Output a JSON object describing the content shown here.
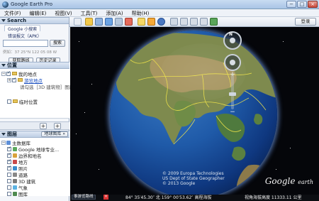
{
  "window": {
    "title": "Google Earth Pro",
    "minimize": "−",
    "maximize": "□",
    "close": "×"
  },
  "menu": [
    "文件(F)",
    "编辑(E)",
    "视图(V)",
    "工具(T)",
    "添加(A)",
    "帮助(H)"
  ],
  "search": {
    "header": "Search",
    "tab1": "Google 小搜索",
    "tab2": "错误报文（APK）",
    "placeholder": "",
    "button": "搜索",
    "hint": "例如：37 25°N 122 05 08 W",
    "link_directions": "获取路线",
    "link_history": "历史记录"
  },
  "places": {
    "header": "位置",
    "items": [
      {
        "label": "我的地点",
        "checked": true
      },
      {
        "label": "游览地点",
        "checked": true
      },
      {
        "label": "请勾选［3D 建筑物］图层",
        "checked": false
      },
      {
        "label": "临时位置",
        "checked": false
      }
    ]
  },
  "layers": {
    "header": "图层",
    "gallery_button": "地球图库 »",
    "items": [
      {
        "label": "主数据库",
        "icon_color": "#5d8fd8",
        "checked": false
      },
      {
        "label": "Google 地球专业...",
        "icon_color": "#5aa95d",
        "checked": true
      },
      {
        "label": "边界和地名",
        "icon_color": "#d9a23a",
        "checked": true
      },
      {
        "label": "地方",
        "icon_color": "#c94848",
        "checked": true
      },
      {
        "label": "照片",
        "icon_color": "#3b8ccc",
        "checked": true
      },
      {
        "label": "道路",
        "icon_color": "#888888",
        "checked": false
      },
      {
        "label": "3D 建筑",
        "icon_color": "#7a7a7a",
        "checked": false
      },
      {
        "label": "气象",
        "icon_color": "#5cb3e3",
        "checked": false
      },
      {
        "label": "图库",
        "icon_color": "#4f8a4f",
        "checked": false
      }
    ]
  },
  "toolbar": {
    "login": "登录"
  },
  "map": {
    "copyright_lines": [
      "© 2009 Europa Technologies",
      "US Dept of State Geographer",
      "© 2013 Google"
    ],
    "logo_main": "Google",
    "logo_sub": "earth"
  },
  "nav": {
    "north": "N"
  },
  "status": {
    "tour": "事游览路线",
    "close": "×",
    "coords": "84° 35′45.30″ 北 159° 00′53.62″ 高程海拔",
    "elevation": "视角海拔高度 11333.11 公里"
  }
}
